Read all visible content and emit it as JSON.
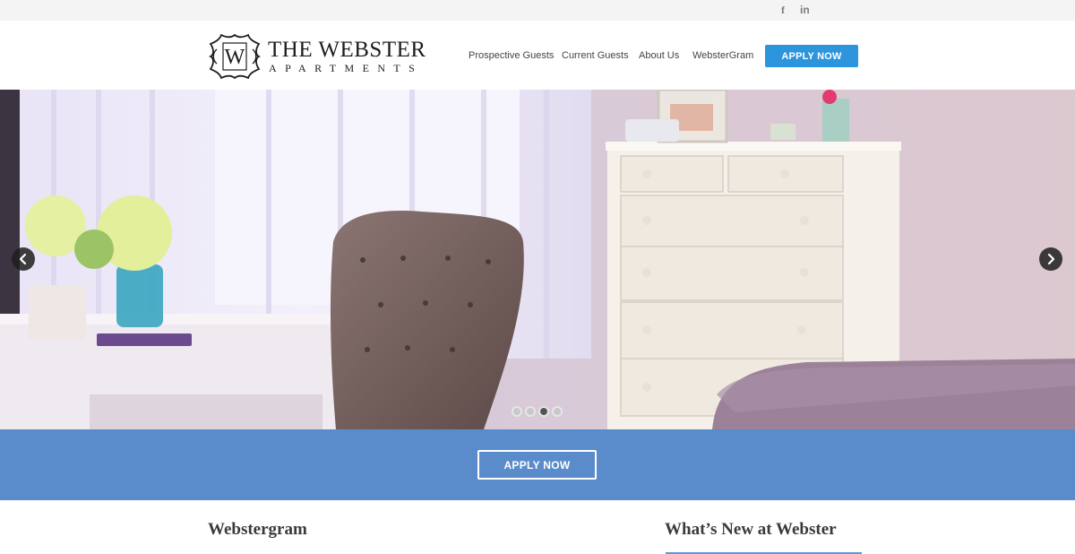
{
  "social": {
    "facebook_glyph": "f",
    "linkedin_glyph": "in"
  },
  "logo": {
    "monogram": "W",
    "title": "THE WEBSTER",
    "subtitle": "APARTMENTS"
  },
  "nav": {
    "items": [
      {
        "label": "Prospective Guests"
      },
      {
        "label": "Current Guests"
      },
      {
        "label": "About Us"
      },
      {
        "label": "WebsterGram"
      }
    ],
    "cta_label": "APPLY NOW"
  },
  "slider": {
    "slide_count": 4,
    "active_slide": 3
  },
  "band": {
    "cta_label": "APPLY NOW"
  },
  "sections": {
    "left_heading": "Webstergram",
    "right_heading": "What’s New at Webster"
  },
  "colors": {
    "primary_button": "#2c95db",
    "band": "#5a8ccb",
    "accent_underline": "#5a9bd5"
  }
}
